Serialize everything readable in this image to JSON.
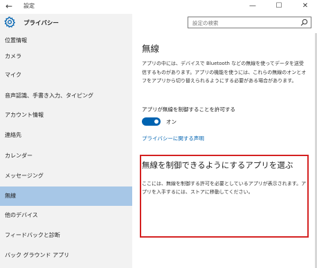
{
  "window": {
    "title": "設定",
    "back_symbol": "←",
    "minimize_symbol": "—",
    "maximize_symbol": "☐",
    "close_symbol": "✕"
  },
  "sidebar": {
    "header": "プライバシー",
    "icon": "gear-icon",
    "items": [
      {
        "label": "位置情報"
      },
      {
        "label": "カメラ"
      },
      {
        "label": "マイク"
      },
      {
        "label": "音声認識、手書き入力、タイピング"
      },
      {
        "label": "アカウント情報"
      },
      {
        "label": "連絡先"
      },
      {
        "label": "カレンダー"
      },
      {
        "label": "メッセージング"
      },
      {
        "label": "無線",
        "active": true
      },
      {
        "label": "他のデバイス"
      },
      {
        "label": "フィードバックと診断"
      },
      {
        "label": "バック グラウンド アプリ"
      }
    ]
  },
  "search": {
    "placeholder": "設定の検索",
    "icon": "search-icon"
  },
  "main": {
    "title": "無線",
    "description": "アプリの中には、デバイスで Bluetooth などの無線を使ってデータを送受信するものがあります。アプリの機能を使うには、これらの無線のオンとオフをアプリから切り替えられるようにする必要がある場合があります。",
    "toggle_label": "アプリが無線を制御することを許可する",
    "toggle_state": "オン",
    "toggle_on": true,
    "privacy_link": "プライバシーに関する声明",
    "section_title": "無線を制御できるようにするアプリを選ぶ",
    "section_description": "ここには、無線を制御する許可を必要としているアプリが表示されます。アプリを入手するには、ストアに移動してください。"
  },
  "colors": {
    "accent": "#0063b1",
    "sidebar_bg": "#f2f2f2",
    "active_item": "#a7c7e7",
    "highlight": "#d42020"
  }
}
